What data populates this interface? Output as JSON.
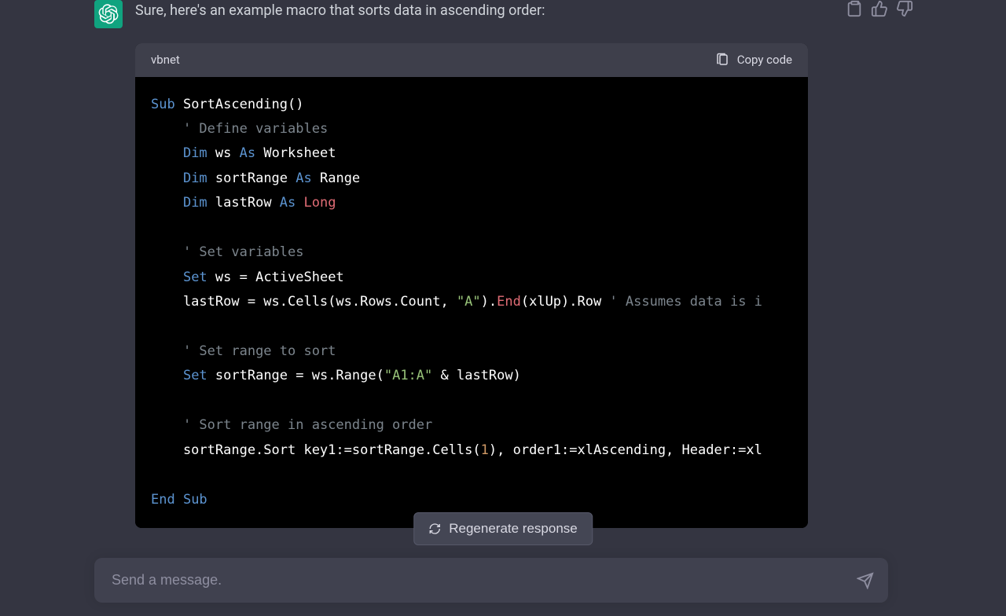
{
  "message": {
    "intro": "Sure, here's an example macro that sorts data in ascending order:"
  },
  "code": {
    "language": "vbnet",
    "copy_label": "Copy code",
    "lines": {
      "l1_sub": "Sub",
      "l1_name": " SortAscending()",
      "l2": "    ",
      "l2_cmt": "' Define variables",
      "l3": "    ",
      "l3_dim": "Dim",
      "l3_sp": " ws ",
      "l3_as": "As",
      "l3_end": " Worksheet",
      "l4": "    ",
      "l4_dim": "Dim",
      "l4_sp": " sortRange ",
      "l4_as": "As",
      "l4_end": " Range",
      "l5": "    ",
      "l5_dim": "Dim",
      "l5_sp": " lastRow ",
      "l5_as": "As",
      "l5_sp2": " ",
      "l5_long": "Long",
      "blank1": "",
      "l6": "    ",
      "l6_cmt": "' Set variables",
      "l7": "    ",
      "l7_set": "Set",
      "l7_end": " ws = ActiveSheet",
      "l8": "    lastRow = ws.Cells(ws.Rows.Count, ",
      "l8_str": "\"A\"",
      "l8_mid": ").",
      "l8_end": "End",
      "l8_rest": "(xlUp).Row ",
      "l8_cmt": "' Assumes data is i",
      "blank2": "",
      "l9": "    ",
      "l9_cmt": "' Set range to sort",
      "l10": "    ",
      "l10_set": "Set",
      "l10_mid": " sortRange = ws.Range(",
      "l10_str": "\"A1:A\"",
      "l10_end": " & lastRow)",
      "blank3": "",
      "l11": "    ",
      "l11_cmt": "' Sort range in ascending order",
      "l12": "    sortRange.Sort key1:=sortRange.Cells(",
      "l12_num": "1",
      "l12_end": "), order1:=xlAscending, Header:=xl",
      "blank4": "",
      "l13_end": "End",
      "l13_sub": " Sub"
    }
  },
  "buttons": {
    "regenerate": "Regenerate response"
  },
  "input": {
    "placeholder": "Send a message."
  }
}
